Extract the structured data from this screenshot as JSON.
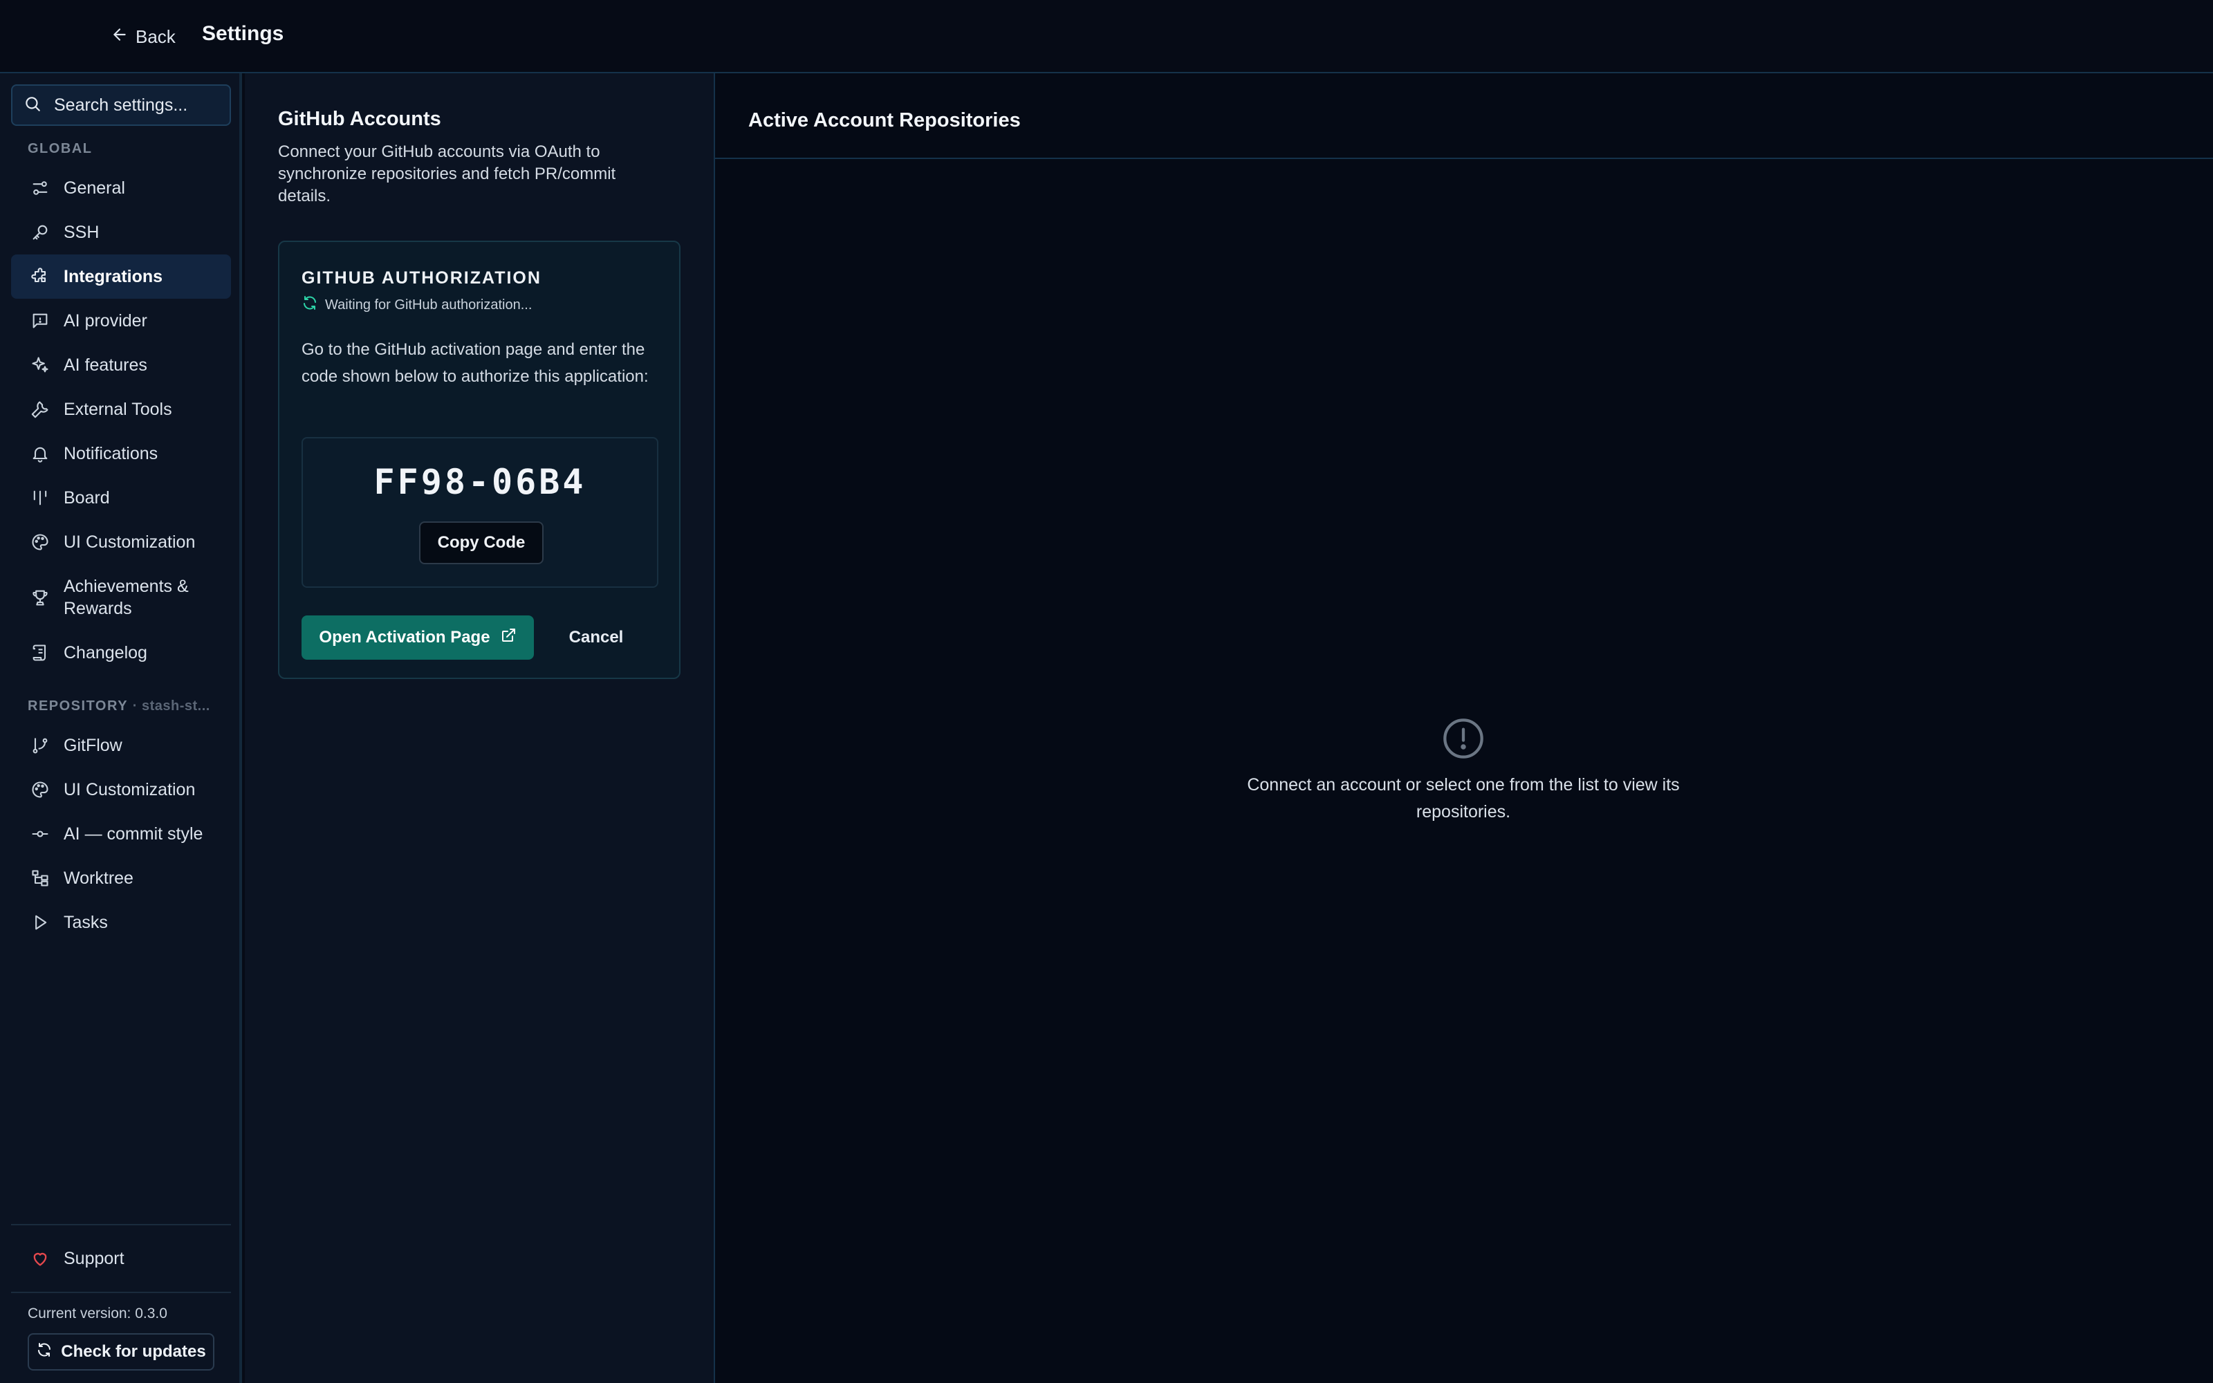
{
  "topbar": {
    "back_label": "Back",
    "title": "Settings"
  },
  "sidebar": {
    "search_placeholder": "Search settings...",
    "global_label": "GLOBAL",
    "global_items": [
      {
        "label": "General",
        "icon": "sliders-icon"
      },
      {
        "label": "SSH",
        "icon": "key-icon"
      },
      {
        "label": "Integrations",
        "icon": "puzzle-icon",
        "active": true
      },
      {
        "label": "AI provider",
        "icon": "message-icon"
      },
      {
        "label": "AI features",
        "icon": "sparkles-icon"
      },
      {
        "label": "External Tools",
        "icon": "wrench-icon"
      },
      {
        "label": "Notifications",
        "icon": "bell-icon"
      },
      {
        "label": "Board",
        "icon": "columns-icon"
      },
      {
        "label": "UI Customization",
        "icon": "palette-icon"
      },
      {
        "label": "Achievements & Rewards",
        "icon": "trophy-icon"
      },
      {
        "label": "Changelog",
        "icon": "scroll-icon"
      }
    ],
    "repository_label": "REPOSITORY",
    "repository_name": "· stash-st...",
    "repository_items": [
      {
        "label": "GitFlow",
        "icon": "git-branch-icon"
      },
      {
        "label": "UI Customization",
        "icon": "palette-icon"
      },
      {
        "label": "AI — commit style",
        "icon": "git-commit-icon"
      },
      {
        "label": "Worktree",
        "icon": "tree-icon"
      },
      {
        "label": "Tasks",
        "icon": "play-icon"
      }
    ],
    "support_label": "Support",
    "version_text": "Current version: 0.3.0",
    "update_label": "Check for updates"
  },
  "github": {
    "title": "GitHub Accounts",
    "description": "Connect your GitHub accounts via OAuth to synchronize repositories and fetch PR/commit details.",
    "auth_title": "GITHUB AUTHORIZATION",
    "auth_status": "Waiting for GitHub authorization...",
    "auth_instructions": "Go to the GitHub activation page and enter the code shown below to authorize this application:",
    "device_code": "FF98-06B4",
    "copy_label": "Copy Code",
    "open_label": "Open Activation Page",
    "cancel_label": "Cancel"
  },
  "repos": {
    "title": "Active Account Repositories",
    "empty_text": "Connect an account or select one from the list to view its repositories."
  },
  "colors": {
    "accent": "#0d6e63",
    "status_spinner": "#2dd4a8",
    "support_heart": "#e5484d"
  }
}
